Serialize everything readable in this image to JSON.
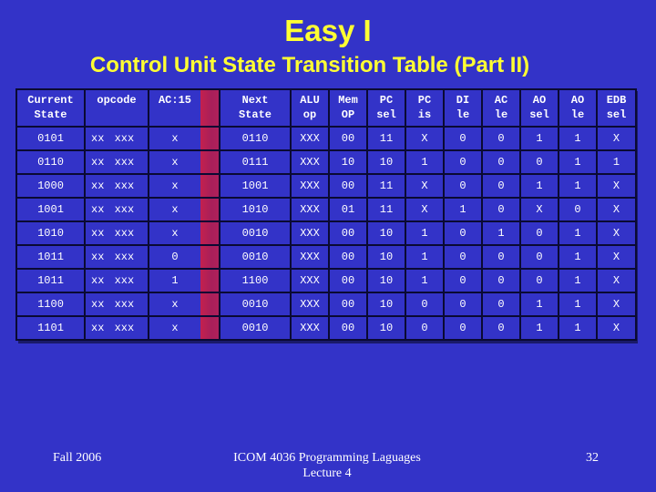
{
  "slide": {
    "title": "Easy I",
    "subtitle": "Control Unit State Transition Table (Part II)",
    "colors": {
      "background": "#3333c8",
      "title": "#ffff33",
      "text": "#ffffff",
      "grid": "#0a0a33",
      "highlight_bar": "#b0205a"
    }
  },
  "table": {
    "headers": [
      {
        "line1": "Current",
        "line2": "State"
      },
      {
        "line1": "opcode",
        "line2": ""
      },
      {
        "line1": "AC:15",
        "line2": ""
      },
      {
        "line1": "Next",
        "line2": "State"
      },
      {
        "line1": "ALU",
        "line2": "op"
      },
      {
        "line1": "Mem",
        "line2": "OP"
      },
      {
        "line1": "PC",
        "line2": "sel"
      },
      {
        "line1": "PC",
        "line2": "is"
      },
      {
        "line1": "DI",
        "line2": "le"
      },
      {
        "line1": "AC",
        "line2": "le"
      },
      {
        "line1": "AO",
        "line2": "sel"
      },
      {
        "line1": "AO",
        "line2": "le"
      },
      {
        "line1": "EDB",
        "line2": "sel"
      }
    ],
    "rows": [
      [
        "0101",
        "xx xxx",
        "x",
        "0110",
        "XXX",
        "00",
        "11",
        "X",
        "0",
        "0",
        "1",
        "1",
        "X"
      ],
      [
        "0110",
        "xx xxx",
        "x",
        "0111",
        "XXX",
        "10",
        "10",
        "1",
        "0",
        "0",
        "0",
        "1",
        "1"
      ],
      [
        "1000",
        "xx xxx",
        "x",
        "1001",
        "XXX",
        "00",
        "11",
        "X",
        "0",
        "0",
        "1",
        "1",
        "X"
      ],
      [
        "1001",
        "xx xxx",
        "x",
        "1010",
        "XXX",
        "01",
        "11",
        "X",
        "1",
        "0",
        "X",
        "0",
        "X"
      ],
      [
        "1010",
        "xx xxx",
        "x",
        "0010",
        "XXX",
        "00",
        "10",
        "1",
        "0",
        "1",
        "0",
        "1",
        "X"
      ],
      [
        "1011",
        "xx xxx",
        "0",
        "0010",
        "XXX",
        "00",
        "10",
        "1",
        "0",
        "0",
        "0",
        "1",
        "X"
      ],
      [
        "1011",
        "xx xxx",
        "1",
        "1100",
        "XXX",
        "00",
        "10",
        "1",
        "0",
        "0",
        "0",
        "1",
        "X"
      ],
      [
        "1100",
        "xx xxx",
        "x",
        "0010",
        "XXX",
        "00",
        "10",
        "0",
        "0",
        "0",
        "1",
        "1",
        "X"
      ],
      [
        "1101",
        "xx xxx",
        "x",
        "0010",
        "XXX",
        "00",
        "10",
        "0",
        "0",
        "0",
        "1",
        "1",
        "X"
      ]
    ]
  },
  "footer": {
    "left": "Fall 2006",
    "center_line1": "ICOM 4036 Programming Laguages",
    "center_line2": "Lecture 4",
    "page_number": "32"
  }
}
